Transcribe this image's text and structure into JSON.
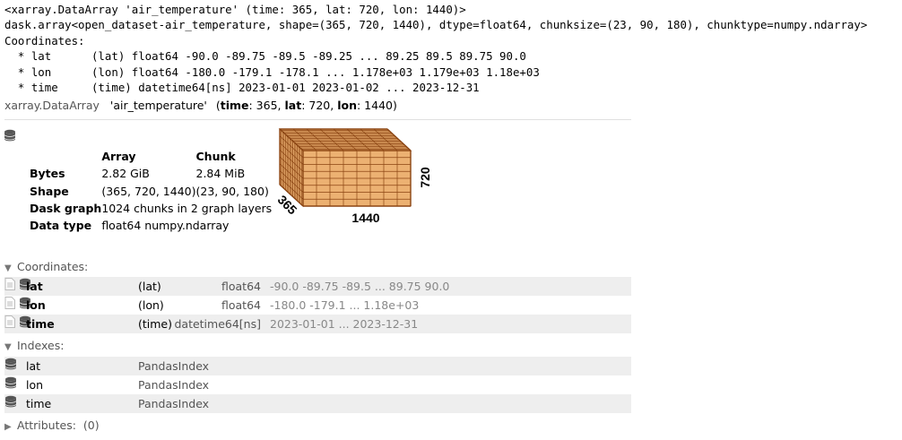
{
  "repr_lines": [
    "<xarray.DataArray 'air_temperature' (time: 365, lat: 720, lon: 1440)>",
    "dask.array<open_dataset-air_temperature, shape=(365, 720, 1440), dtype=float64, chunksize=(23, 90, 180), chunktype=numpy.ndarray>",
    "Coordinates:",
    "  * lat      (lat) float64 -90.0 -89.75 -89.5 -89.25 ... 89.25 89.5 89.75 90.0",
    "  * lon      (lon) float64 -180.0 -179.1 -178.1 ... 1.178e+03 1.179e+03 1.18e+03",
    "  * time     (time) datetime64[ns] 2023-01-01 2023-01-02 ... 2023-12-31"
  ],
  "header": {
    "obj_type": "xarray.DataArray",
    "name": "'air_temperature'",
    "dims": [
      {
        "name": "time",
        "size": ": 365"
      },
      {
        "name": "lat",
        "size": ": 720"
      },
      {
        "name": "lon",
        "size": ": 1440"
      }
    ],
    "open": "(",
    "close": ")",
    "sep": ", "
  },
  "dask": {
    "col_array": "Array",
    "col_chunk": "Chunk",
    "rows": [
      {
        "label": "Bytes",
        "array": "2.82 GiB",
        "chunk": "2.84 MiB"
      },
      {
        "label": "Shape",
        "array": "(365, 720, 1440)",
        "chunk": "(23, 90, 180)"
      },
      {
        "label": "Dask graph",
        "array": "1024 chunks in 2 graph layers",
        "chunk": ""
      },
      {
        "label": "Data type",
        "array": "float64 numpy.ndarray",
        "chunk": ""
      }
    ],
    "cube": {
      "lon_label": "1440",
      "lat_label": "720",
      "time_label": "365"
    }
  },
  "coords": {
    "title": "Coordinates:",
    "rows": [
      {
        "name": "lat",
        "dims": "(lat)",
        "dtype": "float64",
        "preview": "-90.0 -89.75 -89.5 ... 89.75 90.0"
      },
      {
        "name": "lon",
        "dims": "(lon)",
        "dtype": "float64",
        "preview": "-180.0 -179.1 ... 1.18e+03"
      },
      {
        "name": "time",
        "dims": "(time)",
        "dtype": "datetime64[ns]",
        "preview": "2023-01-01 ... 2023-12-31"
      }
    ]
  },
  "indexes": {
    "title": "Indexes:",
    "rows": [
      {
        "name": "lat",
        "type": "PandasIndex"
      },
      {
        "name": "lon",
        "type": "PandasIndex"
      },
      {
        "name": "time",
        "type": "PandasIndex"
      }
    ]
  },
  "attributes": {
    "title": "Attributes:",
    "count": "(0)"
  },
  "icons": {
    "expanded": "caret-down-icon",
    "collapsed": "caret-right-icon",
    "data": "database-icon",
    "attrs": "file-text-icon"
  },
  "colors": {
    "cube_fill": "#ecb172",
    "cube_line": "#8b4513",
    "row_bg": "#eeeeee"
  }
}
